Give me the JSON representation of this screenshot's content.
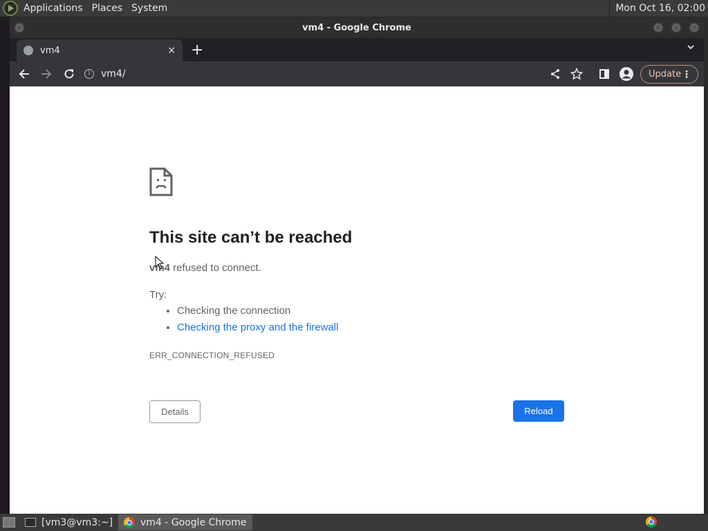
{
  "top_panel": {
    "menus": [
      "Applications",
      "Places",
      "System"
    ],
    "clock": "Mon Oct 16, 02:00"
  },
  "window": {
    "title": "vm4 - Google Chrome"
  },
  "tab": {
    "title": "vm4",
    "close": "×",
    "new_tab": "+"
  },
  "toolbar": {
    "url": "vm4/",
    "update_label": "Update"
  },
  "error_page": {
    "title": "This site can’t be reached",
    "host": "vm4",
    "message": "refused to connect.",
    "try_label": "Try:",
    "suggestions": [
      "Checking the connection",
      "Checking the proxy and the firewall"
    ],
    "error_code": "ERR_CONNECTION_REFUSED",
    "details_label": "Details",
    "reload_label": "Reload"
  },
  "taskbar": {
    "items": [
      "[vm3@vm3:~]",
      "vm4 - Google Chrome"
    ]
  },
  "colors": {
    "accent": "#1a73e8",
    "toolbar": "#35363a",
    "tabstrip": "#202124"
  }
}
